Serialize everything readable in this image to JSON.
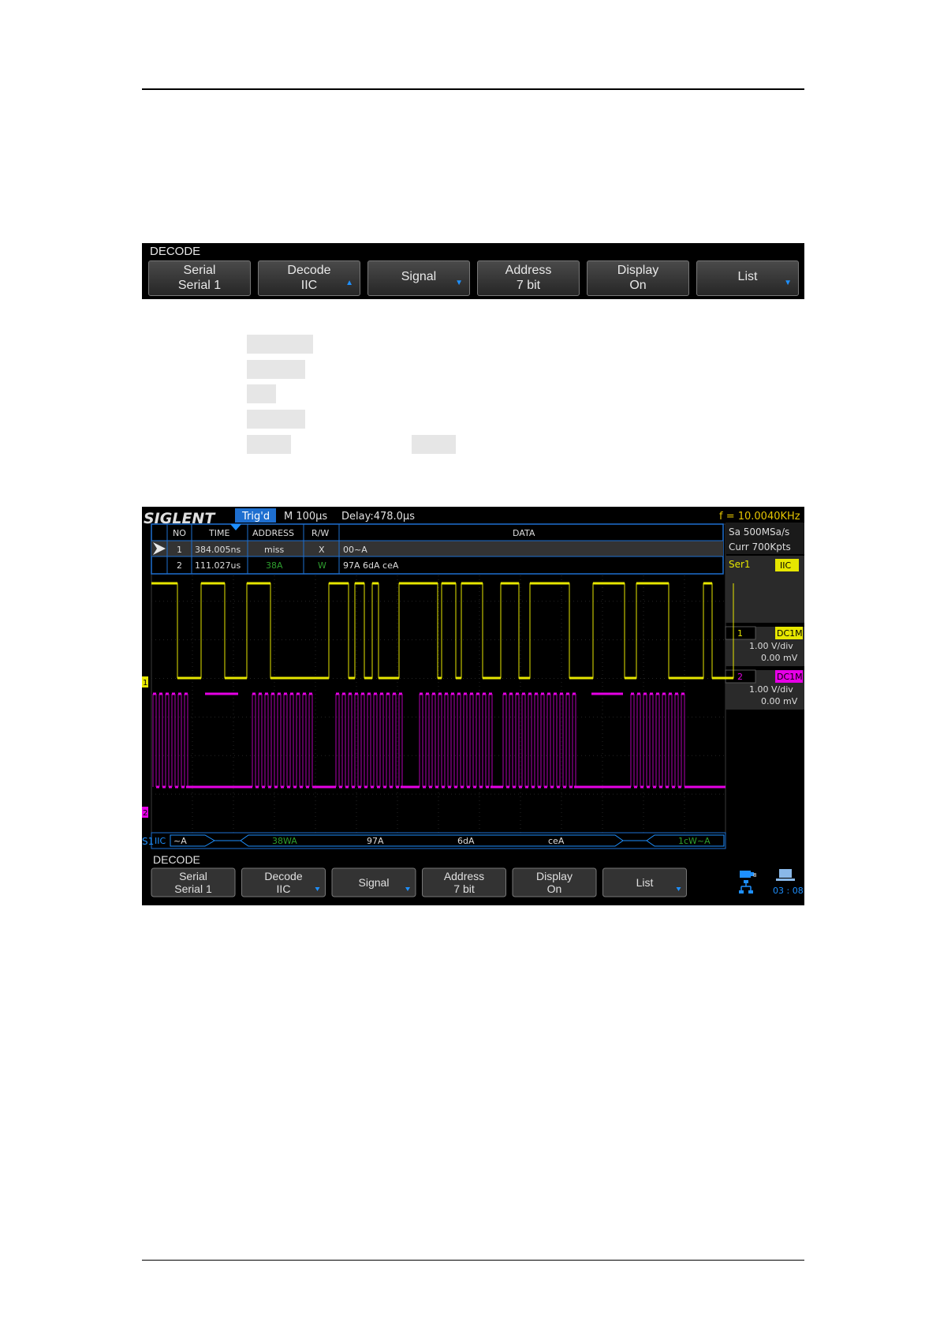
{
  "menu": {
    "title": "DECODE",
    "keys": [
      {
        "line1": "Serial",
        "line2": "Serial 1",
        "arrow": false
      },
      {
        "line1": "Decode",
        "line2": "IIC",
        "arrow": true
      },
      {
        "line1": "Signal",
        "line2": "",
        "arrow": true
      },
      {
        "line1": "Address",
        "line2": "7 bit",
        "arrow": false
      },
      {
        "line1": "Display",
        "line2": "On",
        "arrow": false
      },
      {
        "line1": "List",
        "line2": "",
        "arrow": true
      }
    ]
  },
  "scope": {
    "brand": "SIGLENT",
    "status": "Trig'd",
    "timebase": "M 100μs",
    "delay": "Delay:478.0μs",
    "frequency": "f = 10.0040KHz",
    "sample_rate": "Sa 500MSa/s",
    "memory_depth": "Curr 700Kpts",
    "list_headers": [
      "NO",
      "TIME",
      "ADDRESS",
      "R/W",
      "DATA"
    ],
    "list_rows": [
      {
        "no": "1",
        "time": "384.005ns",
        "address": "miss",
        "rw": "X",
        "data": "00~A"
      },
      {
        "no": "2",
        "time": "111.027us",
        "address": "38A",
        "rw": "W",
        "data": "97A 6dA ceA"
      }
    ],
    "serial_label": "Ser1",
    "protocol": "IIC",
    "channels": [
      {
        "num": "1",
        "coupling": "DC1M",
        "scale": "1.00 V/div",
        "offset": "0.00 mV",
        "color": "#e6e600"
      },
      {
        "num": "2",
        "coupling": "DC1M",
        "scale": "1.00 V/div",
        "offset": "0.00 mV",
        "color": "#e600e6"
      }
    ],
    "bus_marker": "S1",
    "bus_protocol": "IIC",
    "bus_segments": [
      "~A",
      "38WA",
      "97A",
      "6dA",
      "ceA",
      "1cW~A"
    ],
    "ch1_marker": "1",
    "ch2_marker": "2",
    "time": "03 : 08",
    "menu": {
      "title": "DECODE",
      "keys": [
        {
          "line1": "Serial",
          "line2": "Serial 1"
        },
        {
          "line1": "Decode",
          "line2": "IIC"
        },
        {
          "line1": "Signal",
          "line2": ""
        },
        {
          "line1": "Address",
          "line2": "7 bit"
        },
        {
          "line1": "Display",
          "line2": "On"
        },
        {
          "line1": "List",
          "line2": ""
        }
      ]
    },
    "colors": {
      "ch1": "#e6e600",
      "ch2": "#e600e6",
      "accent": "#1e90ff",
      "decode_green": "#2e9e2e"
    }
  }
}
